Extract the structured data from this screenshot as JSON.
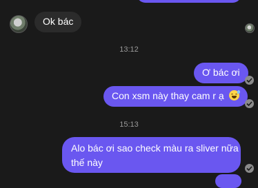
{
  "messages": [
    {
      "text": "Ok bác"
    },
    {
      "text": "Ơ bác ơi"
    },
    {
      "text": "Con xsm này thay cam r ạ"
    },
    {
      "line1": "Alo bác ơi sao check màu ra sliver nữa",
      "line2": "thế này"
    }
  ],
  "timestamps": [
    "13:12",
    "15:13"
  ],
  "icons": {
    "avatar": "contact-avatar",
    "read": "read-receipt-check-icon",
    "emoji": "sweat-smile-emoji"
  },
  "colors": {
    "background": "#1a1a1a",
    "incoming_bubble": "#2b2b2b",
    "outgoing_bubble": "#6a57f0"
  }
}
